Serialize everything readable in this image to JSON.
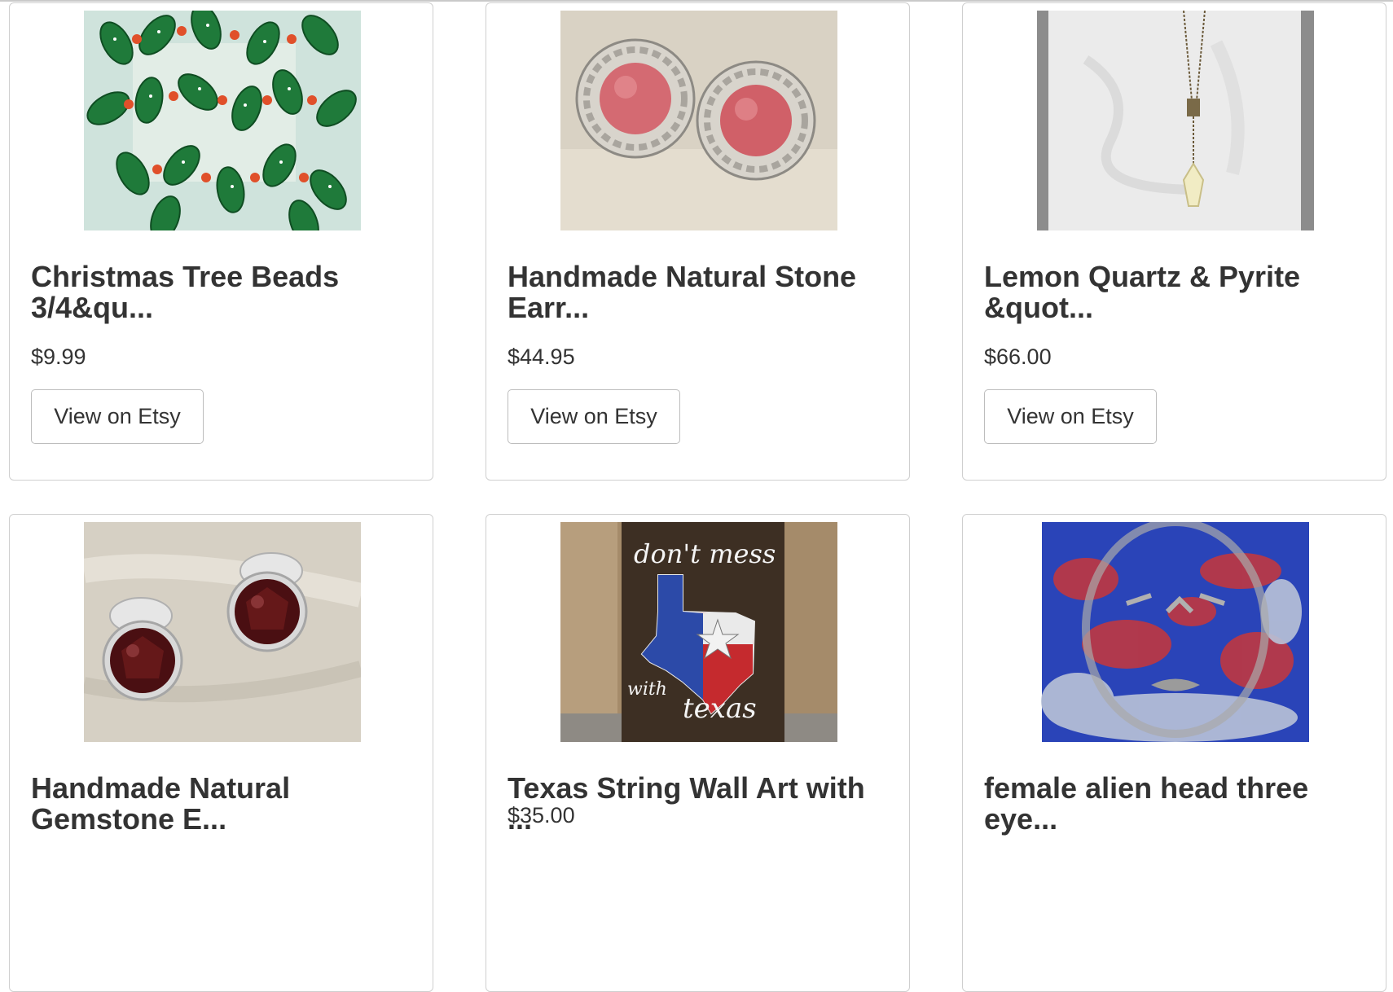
{
  "listings": [
    {
      "title": "Christmas Tree Beads 3/4&qu...",
      "price": "$9.99",
      "button": "View on Etsy",
      "image_icon": "christmas-tree-beads-photo"
    },
    {
      "title": "Handmade Natural Stone Earr...",
      "price": "$44.95",
      "button": "View on Etsy",
      "image_icon": "pink-stone-earrings-photo"
    },
    {
      "title": "Lemon Quartz & Pyrite &quot...",
      "price": "$66.00",
      "button": "View on Etsy",
      "image_icon": "quartz-pendant-necklace-photo"
    },
    {
      "title": "Handmade Natural Gemstone E...",
      "price": "",
      "button": "",
      "image_icon": "garnet-stud-earrings-photo"
    },
    {
      "title": "Texas String Wall Art with ...",
      "price": "$35.00",
      "button": "",
      "image_icon": "texas-string-art-photo",
      "image_text": [
        "don't mess",
        "with",
        "texas"
      ]
    },
    {
      "title": "female alien head three eye...",
      "price": "",
      "button": "",
      "image_icon": "alien-head-painting-photo"
    }
  ]
}
